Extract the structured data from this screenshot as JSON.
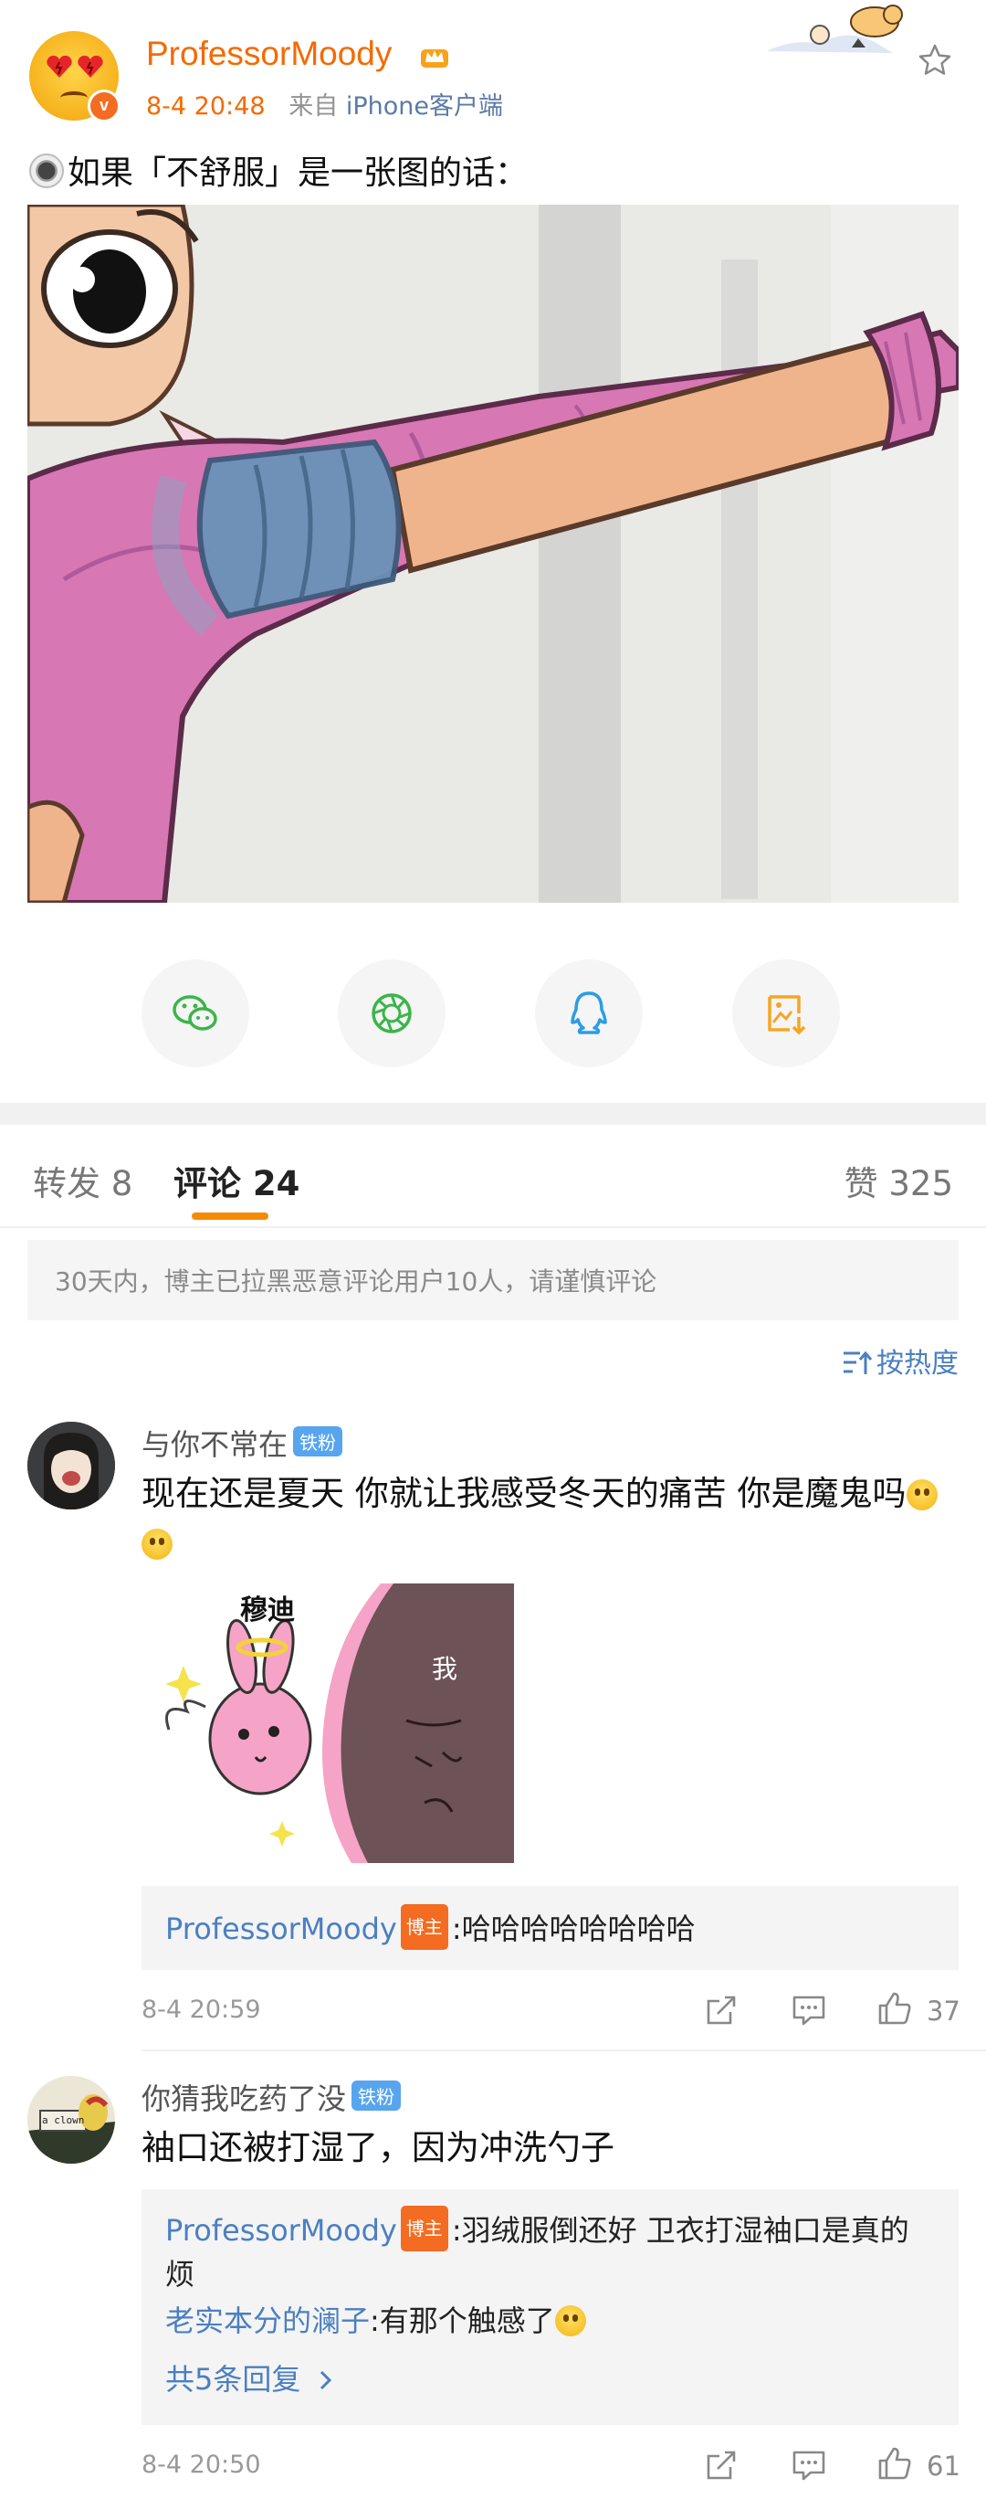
{
  "post": {
    "username": "ProfessorMoody",
    "time": "8-4 20:48",
    "source_prefix": "来自",
    "source": "iPhone客户端",
    "text": "如果「不舒服」是一张图的话："
  },
  "share_icons": [
    "wechat-icon",
    "moments-icon",
    "qq-icon",
    "save-image-icon"
  ],
  "tabs": {
    "repost": "转发 8",
    "comments": "评论 24",
    "likes": "赞 325"
  },
  "notice": "30天内，博主已拉黑恶意评论用户10人，请谨慎评论",
  "sort_label": "按热度",
  "comments": [
    {
      "name": "与你不常在",
      "badge": "铁粉",
      "text": "现在还是夏天 你就让我感受冬天的痛苦 你是魔鬼吗",
      "meme_labels": [
        "穆迪",
        "我"
      ],
      "replies": [
        {
          "user": "ProfessorMoody",
          "badge": "博主",
          "text": ":哈哈哈哈哈哈哈哈"
        }
      ],
      "time": "8-4 20:59",
      "likes": "37"
    },
    {
      "name": "你猜我吃药了没",
      "badge": "铁粉",
      "avatar_text": "a clown",
      "text": "袖口还被打湿了，因为冲洗勺子",
      "replies": [
        {
          "user": "ProfessorMoody",
          "badge": "博主",
          "text": ":羽绒服倒还好 卫衣打湿袖口是真的",
          "text2": "烦"
        },
        {
          "user": "老实本分的澜子",
          "text": ":有那个触感了"
        }
      ],
      "more_replies": "共5条回复",
      "time": "8-4 20:50",
      "likes": "61"
    }
  ],
  "colors": {
    "accent": "#f56a00",
    "link": "#4b7fc1",
    "tab_indicator": "#f58a06"
  }
}
